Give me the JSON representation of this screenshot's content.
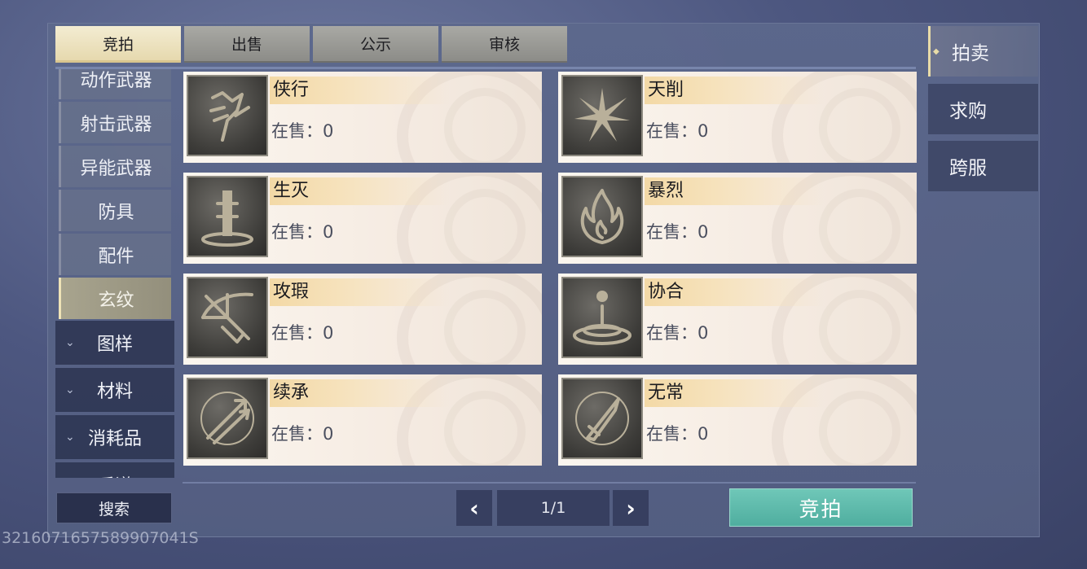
{
  "top_tabs": [
    {
      "label": "竞拍",
      "active": true
    },
    {
      "label": "出售",
      "active": false
    },
    {
      "label": "公示",
      "active": false
    },
    {
      "label": "审核",
      "active": false
    }
  ],
  "categories": {
    "items": [
      {
        "label": "动作武器"
      },
      {
        "label": "射击武器"
      },
      {
        "label": "异能武器"
      },
      {
        "label": "防具"
      },
      {
        "label": "配件"
      },
      {
        "label": "玄纹",
        "selected": true
      }
    ],
    "groups": [
      {
        "label": "图样"
      },
      {
        "label": "材料"
      },
      {
        "label": "消耗品"
      },
      {
        "label": "乐谱"
      }
    ]
  },
  "stock_prefix": "在售：",
  "cards": [
    {
      "name": "侠行",
      "stock": "0",
      "icon": "wing-fist-icon"
    },
    {
      "name": "天削",
      "stock": "0",
      "icon": "starburst-icon"
    },
    {
      "name": "生灭",
      "stock": "0",
      "icon": "totem-pillar-icon"
    },
    {
      "name": "暴烈",
      "stock": "0",
      "icon": "flame-icon"
    },
    {
      "name": "攻瑕",
      "stock": "0",
      "icon": "crossbow-icon"
    },
    {
      "name": "协合",
      "stock": "0",
      "icon": "water-drop-icon"
    },
    {
      "name": "续承",
      "stock": "0",
      "icon": "arrows-circle-icon"
    },
    {
      "name": "无常",
      "stock": "0",
      "icon": "sword-circle-icon"
    }
  ],
  "side_tabs": [
    {
      "label": "拍卖",
      "active": true
    },
    {
      "label": "求购",
      "active": false
    },
    {
      "label": "跨服",
      "active": false
    }
  ],
  "bottom": {
    "search_label": "搜索",
    "page_text": "1/1",
    "bid_label": "竞拍",
    "prev_icon": "chevron-left-icon",
    "next_icon": "chevron-right-icon"
  },
  "uid_text": "3216071657589907041S"
}
